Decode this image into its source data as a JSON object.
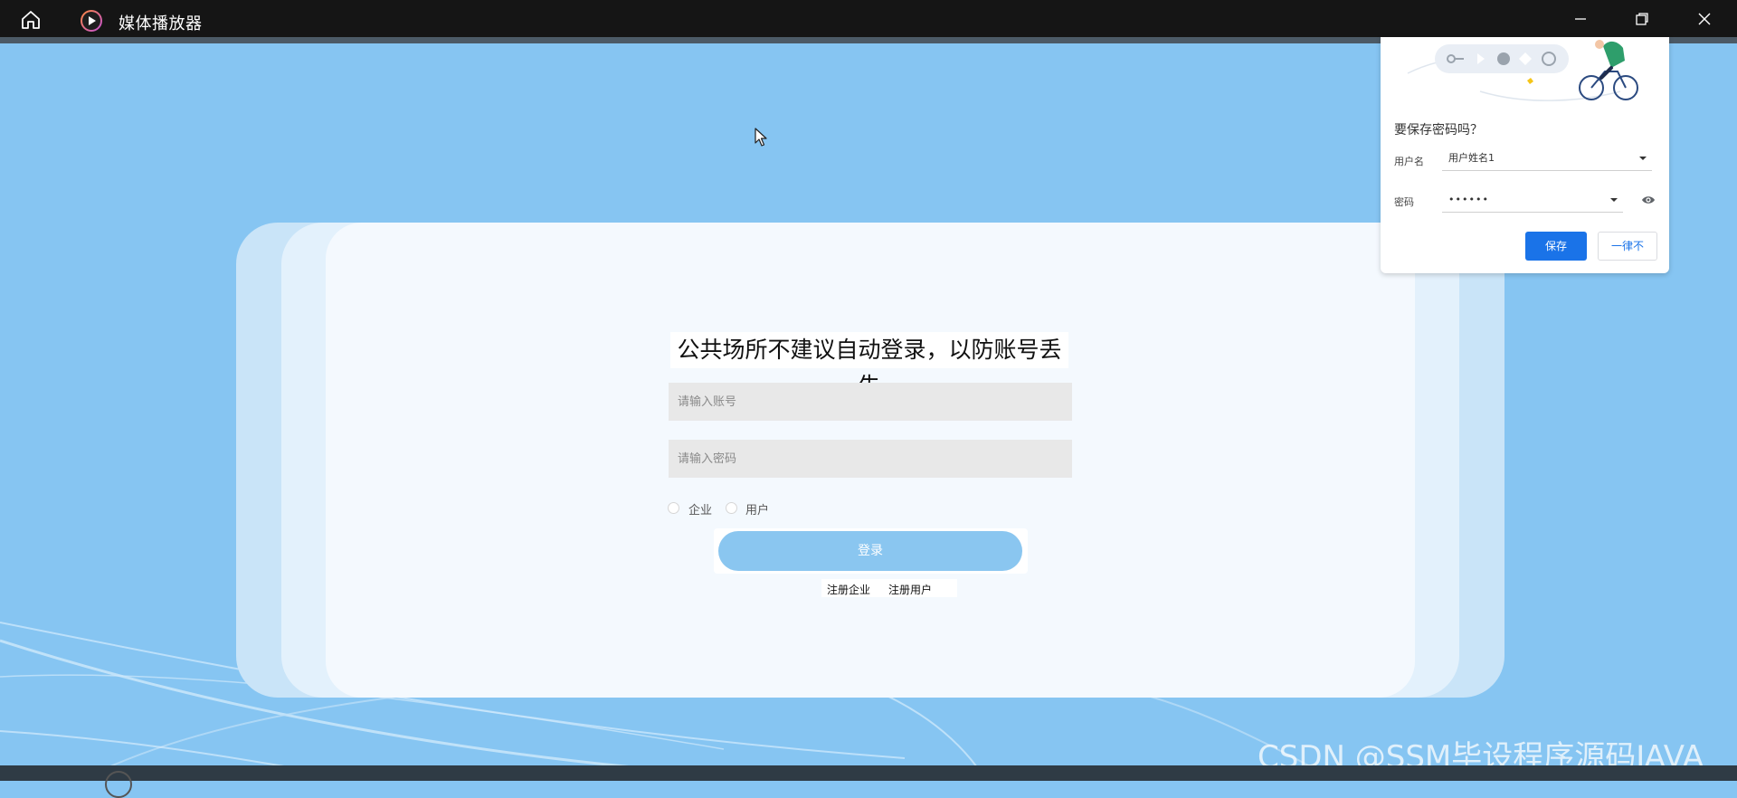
{
  "window": {
    "title": "媒体播放器",
    "home_icon": "home-icon",
    "app_icon": "media-player-icon",
    "minimize_icon": "minimize-icon",
    "maximize_icon": "restore-icon",
    "close_icon": "close-icon"
  },
  "login": {
    "notice": "公共场所不建议自动登录，以防账号丢失",
    "account_placeholder": "请输入账号",
    "password_placeholder": "请输入密码",
    "roles": [
      {
        "label": "企业",
        "checked": false
      },
      {
        "label": "用户",
        "checked": false
      }
    ],
    "login_button": "登录",
    "links": [
      "注册企业",
      "注册用户"
    ]
  },
  "save_password_popup": {
    "heading": "要保存密码吗？",
    "username_label": "用户名",
    "username_value": "用户姓名1",
    "password_label": "密码",
    "password_value": "••••••",
    "save_button": "保存",
    "never_button": "一律不",
    "eye_icon": "eye-icon",
    "illustration": "password-key-bicycle-illustration"
  },
  "watermark": "CSDN @SSM毕设程序源码JAVA",
  "colors": {
    "background": "#86c5f2",
    "titlebar": "#151515",
    "login_button": "#8ac6f0",
    "primary_blue": "#1a73e8"
  }
}
